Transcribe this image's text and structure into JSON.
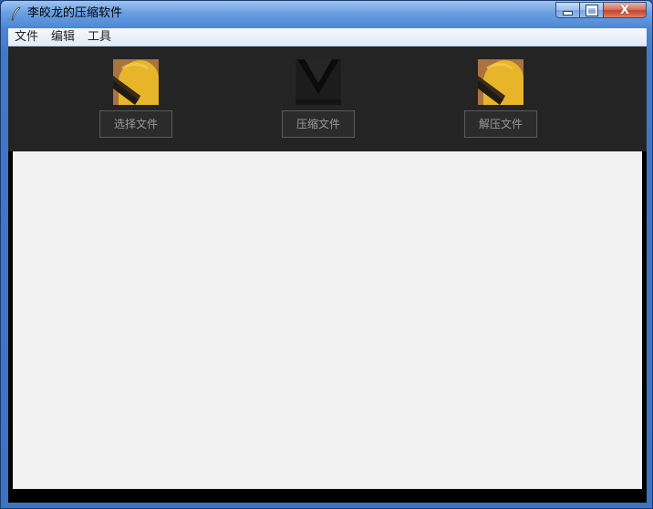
{
  "window": {
    "title": "李皎龙的压缩软件",
    "close_symbol": "X"
  },
  "menubar": {
    "items": [
      {
        "label": "文件"
      },
      {
        "label": "编辑"
      },
      {
        "label": "工具"
      }
    ]
  },
  "toolbar": {
    "tools": [
      {
        "label": "选择文件",
        "icon": "yellow-image-icon"
      },
      {
        "label": "压缩文件",
        "icon": "dark-v-image-icon"
      },
      {
        "label": "解压文件",
        "icon": "yellow-image-icon"
      }
    ]
  },
  "colors": {
    "toolbar_bg": "#242424",
    "content_bg": "#f2f2f2",
    "accent_yellow": "#e8b52a"
  }
}
